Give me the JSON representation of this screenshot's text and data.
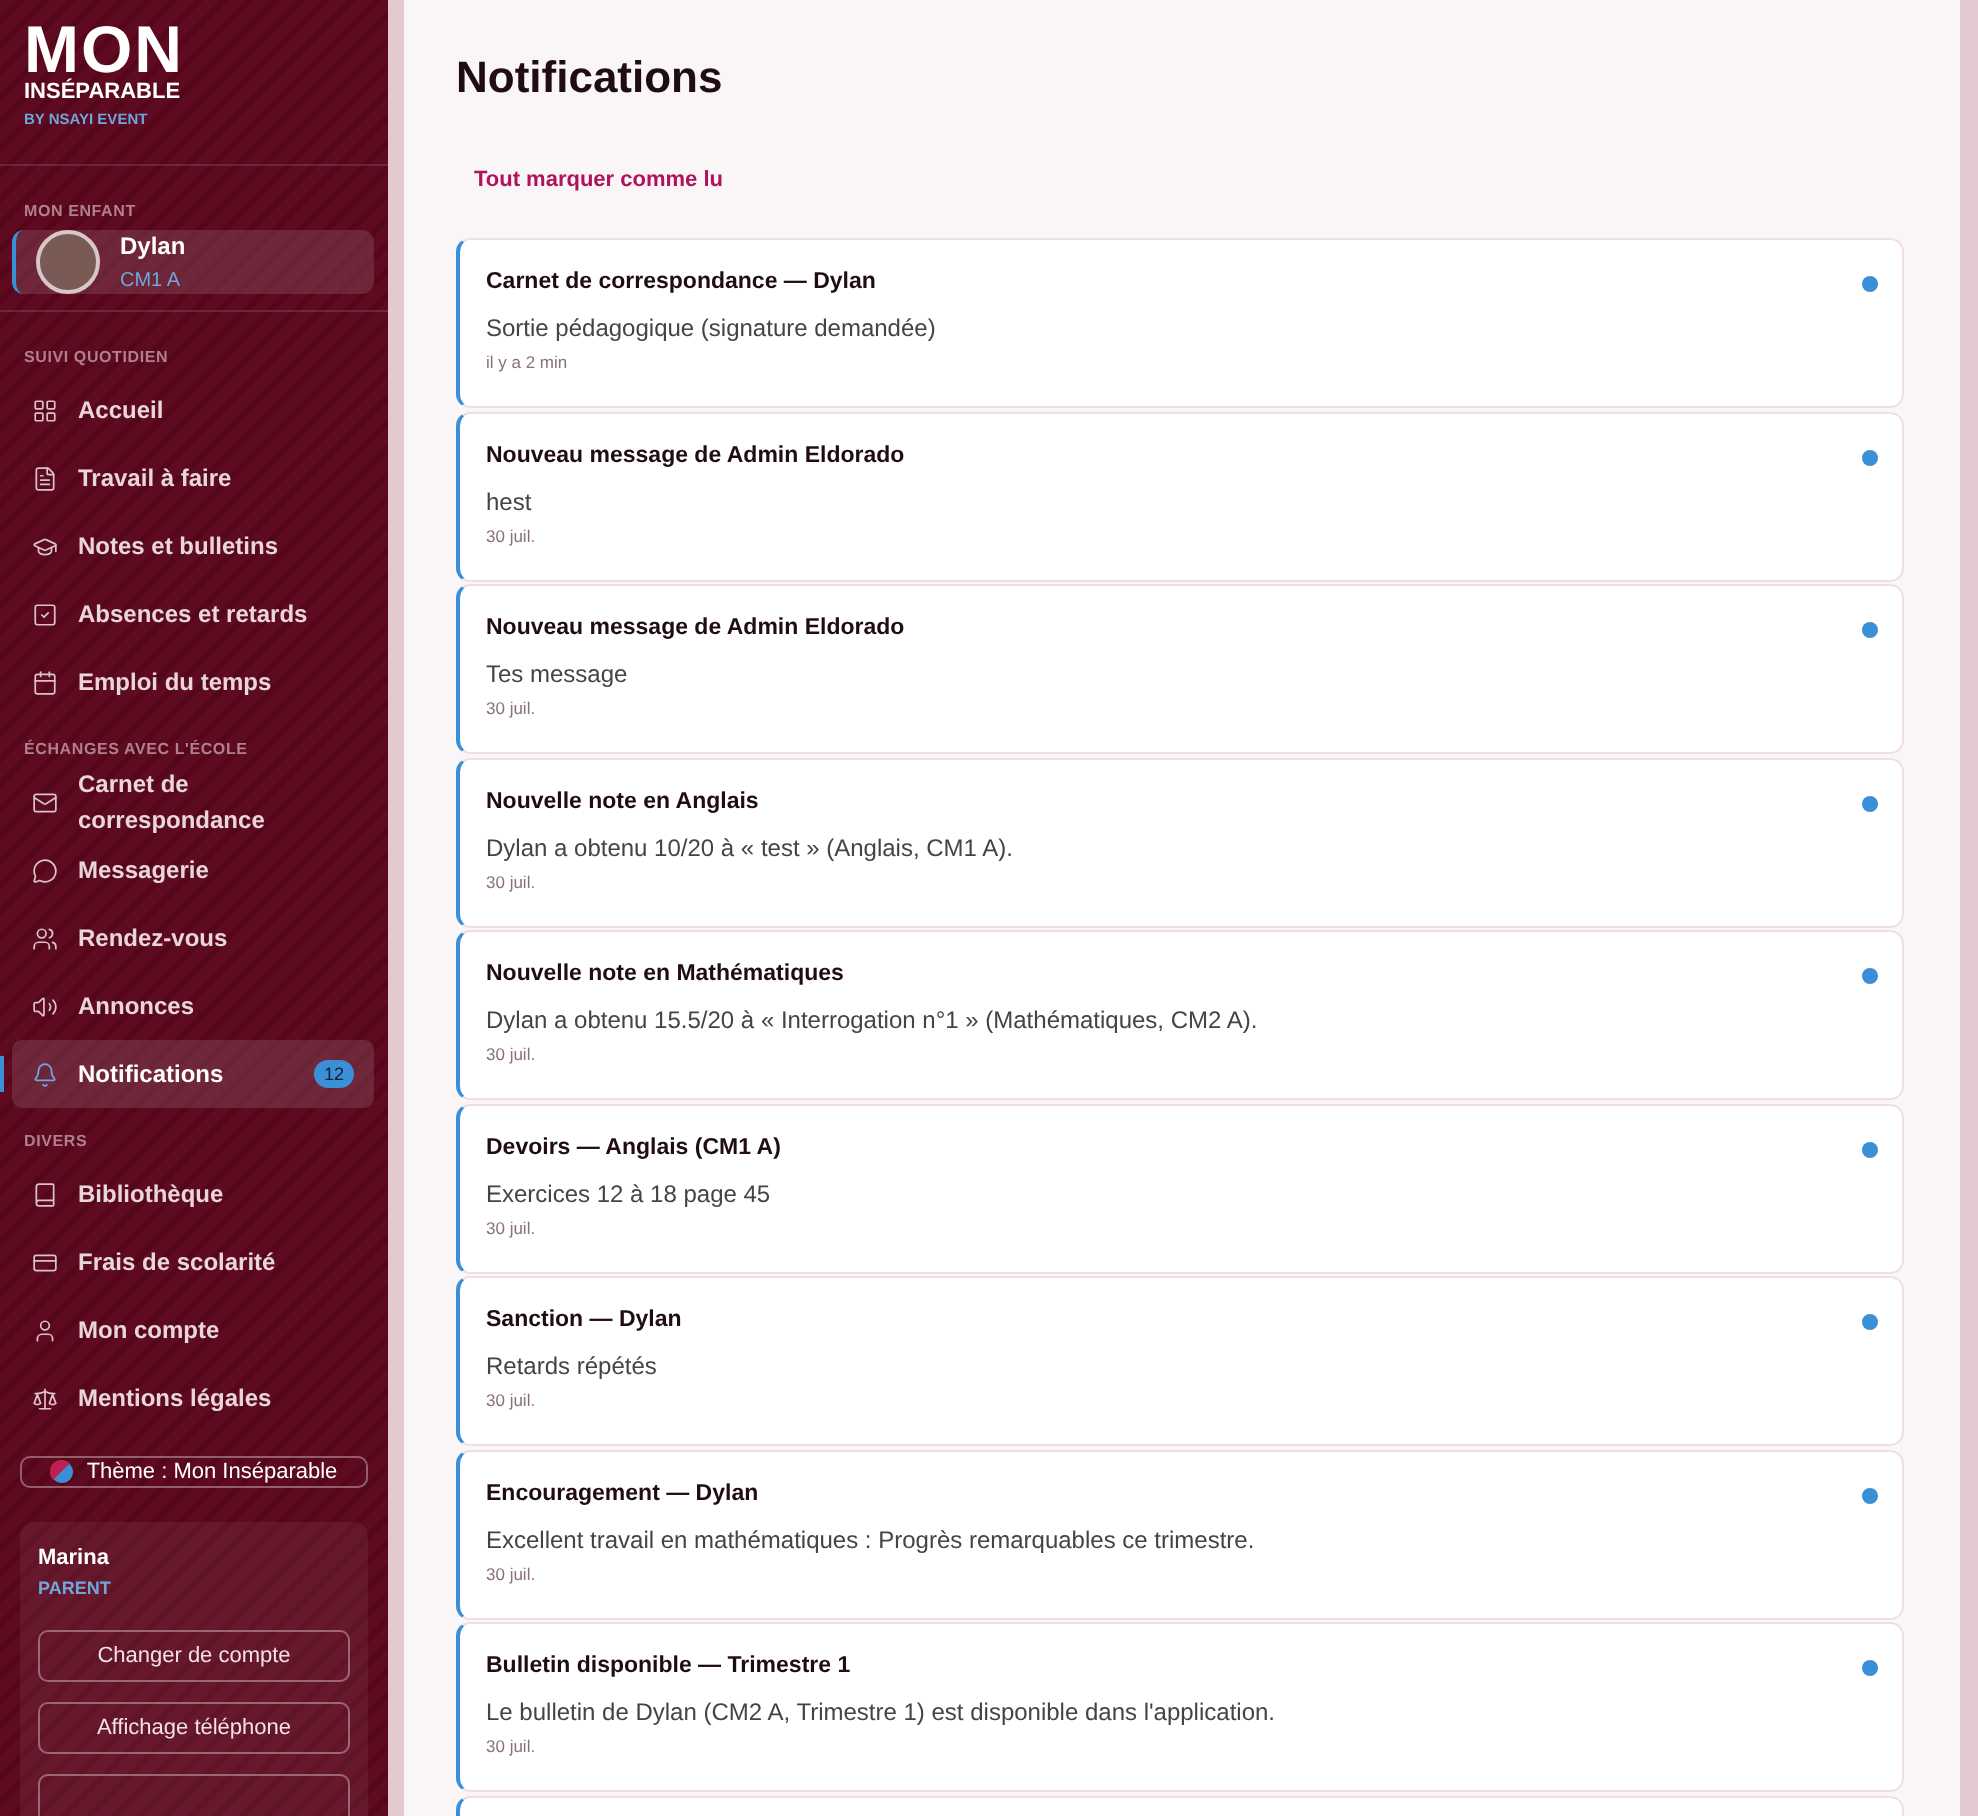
{
  "brand": {
    "name": "MON",
    "subtitle": "INSÉPARABLE",
    "tagline": "BY NSAYI EVENT"
  },
  "child_section": "MON ENFANT",
  "child": {
    "name": "Dylan",
    "class": "CM1 A",
    "selected": true
  },
  "nav_sections": [
    {
      "title": "SUIVI QUOTIDIEN",
      "items": [
        {
          "kind": "grid",
          "label": "Accueil",
          "selected": false
        },
        {
          "kind": "file",
          "label": "Travail à faire",
          "selected": false
        },
        {
          "kind": "cap",
          "label": "Notes et bulletins",
          "selected": false
        },
        {
          "kind": "check",
          "label": "Absences et retards",
          "selected": false
        },
        {
          "kind": "calendar",
          "label": "Emploi du temps",
          "selected": false
        }
      ]
    },
    {
      "title": "ÉCHANGES AVEC L'ÉCOLE",
      "items": [
        {
          "kind": "mail",
          "label": "Carnet de correspondance",
          "selected": false
        },
        {
          "kind": "chat",
          "label": "Messagerie",
          "selected": false
        },
        {
          "kind": "users",
          "label": "Rendez-vous",
          "selected": false
        },
        {
          "kind": "speaker",
          "label": "Annonces",
          "selected": false
        },
        {
          "kind": "bell",
          "label": "Notifications",
          "selected": true,
          "badge": "12"
        }
      ]
    },
    {
      "title": "DIVERS",
      "items": [
        {
          "kind": "book",
          "label": "Bibliothèque",
          "selected": false
        },
        {
          "kind": "card",
          "label": "Frais de scolarité",
          "selected": false
        },
        {
          "kind": "user",
          "label": "Mon compte",
          "selected": false
        },
        {
          "kind": "scale",
          "label": "Mentions légales",
          "selected": false
        }
      ]
    }
  ],
  "theme_button": "Thème : Mon Inséparable",
  "account": {
    "name": "Marina",
    "role": "PARENT",
    "buttons": [
      "Changer de compte",
      "Affichage téléphone"
    ]
  },
  "page_title": "Notifications",
  "mark_all": "Tout marquer comme lu",
  "notifications": [
    {
      "title": "Carnet de correspondance — Dylan",
      "body": "Sortie pédagogique (signature demandée)",
      "time": "il y a 2 min",
      "unread": true
    },
    {
      "title": "Nouveau message de Admin Eldorado",
      "body": "hest",
      "time": "30 juil.",
      "unread": true
    },
    {
      "title": "Nouveau message de Admin Eldorado",
      "body": "Tes message",
      "time": "30 juil.",
      "unread": true
    },
    {
      "title": "Nouvelle note en Anglais",
      "body": "Dylan a obtenu 10/20 à « test » (Anglais, CM1 A).",
      "time": "30 juil.",
      "unread": true
    },
    {
      "title": "Nouvelle note en Mathématiques",
      "body": "Dylan a obtenu 15.5/20 à « Interrogation n°1 » (Mathématiques, CM2 A).",
      "time": "30 juil.",
      "unread": true
    },
    {
      "title": "Devoirs — Anglais (CM1 A)",
      "body": "Exercices 12 à 18 page 45",
      "time": "30 juil.",
      "unread": true
    },
    {
      "title": "Sanction — Dylan",
      "body": "Retards répétés",
      "time": "30 juil.",
      "unread": true
    },
    {
      "title": "Encouragement — Dylan",
      "body": "Excellent travail en mathématiques : Progrès remarquables ce trimestre.",
      "time": "30 juil.",
      "unread": true
    },
    {
      "title": "Bulletin disponible — Trimestre 1",
      "body": "Le bulletin de Dylan (CM2 A, Trimestre 1) est disponible dans l'application.",
      "time": "30 juil.",
      "unread": true
    }
  ]
}
